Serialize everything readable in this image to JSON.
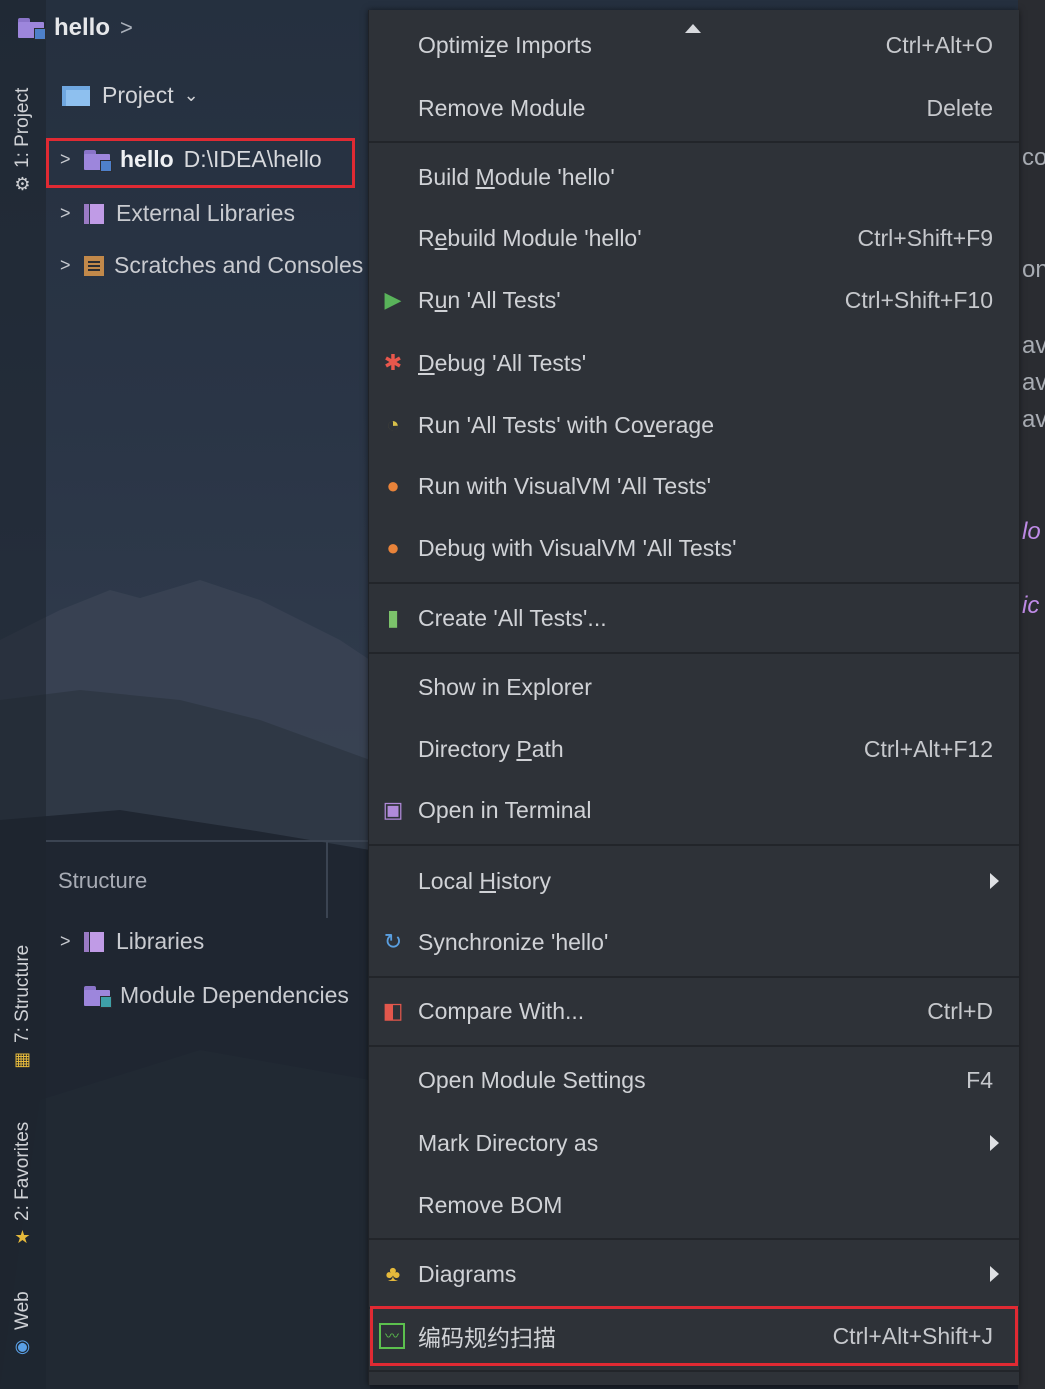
{
  "breadcrumb": {
    "project": "hello"
  },
  "toolstrip": {
    "project_tab": "1: Project",
    "structure_tab": "7: Structure",
    "favorites_tab": "2: Favorites",
    "web_tab": "Web"
  },
  "project_view": {
    "header": "Project",
    "tree": [
      {
        "name": "hello",
        "path": "D:\\IDEA\\hello"
      },
      {
        "name": "External Libraries"
      },
      {
        "name": "Scratches and Consoles"
      }
    ]
  },
  "structure_panel": {
    "title": "Structure",
    "items": [
      {
        "name": "Libraries"
      },
      {
        "name": "Module Dependencies"
      }
    ]
  },
  "context_menu": {
    "items": [
      {
        "pre": "Optimi",
        "u": "z",
        "post": "e Imports",
        "shortcut": "Ctrl+Alt+O"
      },
      {
        "pre": "Remove Module",
        "u": "",
        "post": "",
        "shortcut": "Delete"
      },
      {
        "pre": "Build ",
        "u": "M",
        "post": "odule 'hello'",
        "shortcut": ""
      },
      {
        "pre": "R",
        "u": "e",
        "post": "build Module 'hello'",
        "shortcut": "Ctrl+Shift+F9"
      },
      {
        "pre": "R",
        "u": "u",
        "post": "n 'All Tests'",
        "shortcut": "Ctrl+Shift+F10"
      },
      {
        "pre": "",
        "u": "D",
        "post": "ebug 'All Tests'",
        "shortcut": ""
      },
      {
        "pre": "Run 'All Tests' with Co",
        "u": "v",
        "post": "erage",
        "shortcut": ""
      },
      {
        "pre": "Run with VisualVM 'All Tests'",
        "u": "",
        "post": "",
        "shortcut": ""
      },
      {
        "pre": "Debug with VisualVM 'All Tests'",
        "u": "",
        "post": "",
        "shortcut": ""
      },
      {
        "pre": "Create 'All Tests'...",
        "u": "",
        "post": "",
        "shortcut": ""
      },
      {
        "pre": "Show in Explorer",
        "u": "",
        "post": "",
        "shortcut": ""
      },
      {
        "pre": "Directory ",
        "u": "P",
        "post": "ath",
        "shortcut": "Ctrl+Alt+F12"
      },
      {
        "pre": "Open in Terminal",
        "u": "",
        "post": "",
        "shortcut": ""
      },
      {
        "pre": "Local ",
        "u": "H",
        "post": "istory",
        "shortcut": ""
      },
      {
        "pre": "Synchronize 'hello'",
        "u": "",
        "post": "",
        "shortcut": ""
      },
      {
        "pre": "Compare With...",
        "u": "",
        "post": "",
        "shortcut": "Ctrl+D"
      },
      {
        "pre": "Open Module Settings",
        "u": "",
        "post": "",
        "shortcut": "F4"
      },
      {
        "pre": "Mark Directory as",
        "u": "",
        "post": "",
        "shortcut": ""
      },
      {
        "pre": "Remove BOM",
        "u": "",
        "post": "",
        "shortcut": ""
      },
      {
        "pre": "Diagrams",
        "u": "",
        "post": "",
        "shortcut": ""
      },
      {
        "pre": "编码规约扫描",
        "u": "",
        "post": "",
        "shortcut": "Ctrl+Alt+Shift+J"
      }
    ]
  },
  "editor_fragments": [
    "co",
    "on",
    "av",
    "av",
    "av",
    "lo",
    "ic"
  ],
  "colors": {
    "highlight": "#e02a33",
    "menu_bg": "#2e3238",
    "run_green": "#59b35a",
    "debug_red": "#e8574c"
  }
}
